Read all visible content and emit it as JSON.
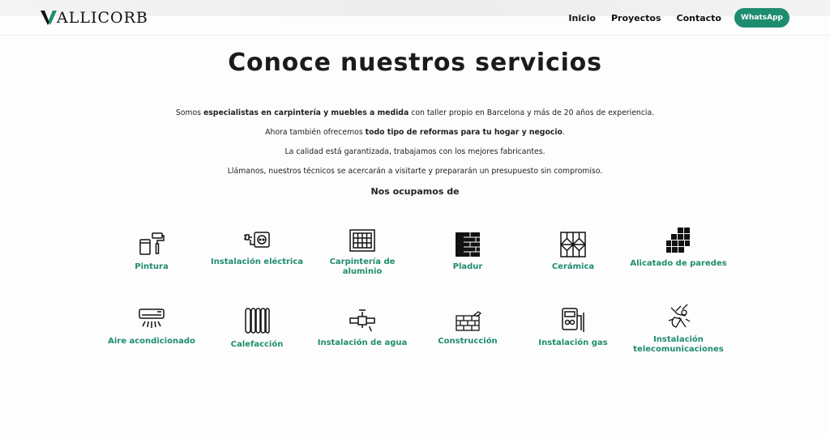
{
  "header": {
    "logo_text": "ALLICORB",
    "nav": [
      "Inicio",
      "Proyectos",
      "Contacto"
    ],
    "whatsapp_label": "WhatsApp"
  },
  "main": {
    "title": "Conoce nuestros servicios",
    "intro": {
      "p1_a": "Somos ",
      "p1_b": "especialistas en carpintería y muebles a medida",
      "p1_c": " con taller propio en Barcelona y más de 20 años de experiencia.",
      "p2_a": "Ahora también ofrecemos ",
      "p2_b": "todo tipo de reformas para tu hogar y negocio",
      "p2_c": ".",
      "p3": "La calidad está garantizada, trabajamos con los mejores fabricantes.",
      "p4": "Llámanos, nuestros técnicos se acercarán a visitarte y prepararán un presupuesto sin compromiso."
    },
    "subtitle": "Nos ocupamos de",
    "services": [
      {
        "label": "Pintura",
        "icon": "paint-roller-icon"
      },
      {
        "label": "Instalación eléctrica",
        "icon": "electric-outlet-icon"
      },
      {
        "label": "Carpintería de aluminio",
        "icon": "window-frame-icon"
      },
      {
        "label": "Pladur",
        "icon": "brick-panel-icon"
      },
      {
        "label": "Cerámica",
        "icon": "tile-pattern-icon"
      },
      {
        "label": "Alicatado de paredes",
        "icon": "wall-tiles-icon"
      },
      {
        "label": "Aire acondicionado",
        "icon": "air-conditioner-icon"
      },
      {
        "label": "Calefacción",
        "icon": "radiator-icon"
      },
      {
        "label": "Instalación de agua",
        "icon": "water-pipe-icon"
      },
      {
        "label": "Construcción",
        "icon": "brick-wall-icon"
      },
      {
        "label": "Instalación gas",
        "icon": "gas-meter-icon"
      },
      {
        "label": "Instalación telecomunicaciones",
        "icon": "satellite-icon"
      }
    ]
  },
  "colors": {
    "accent": "#1e8c6e",
    "text": "#222222"
  }
}
